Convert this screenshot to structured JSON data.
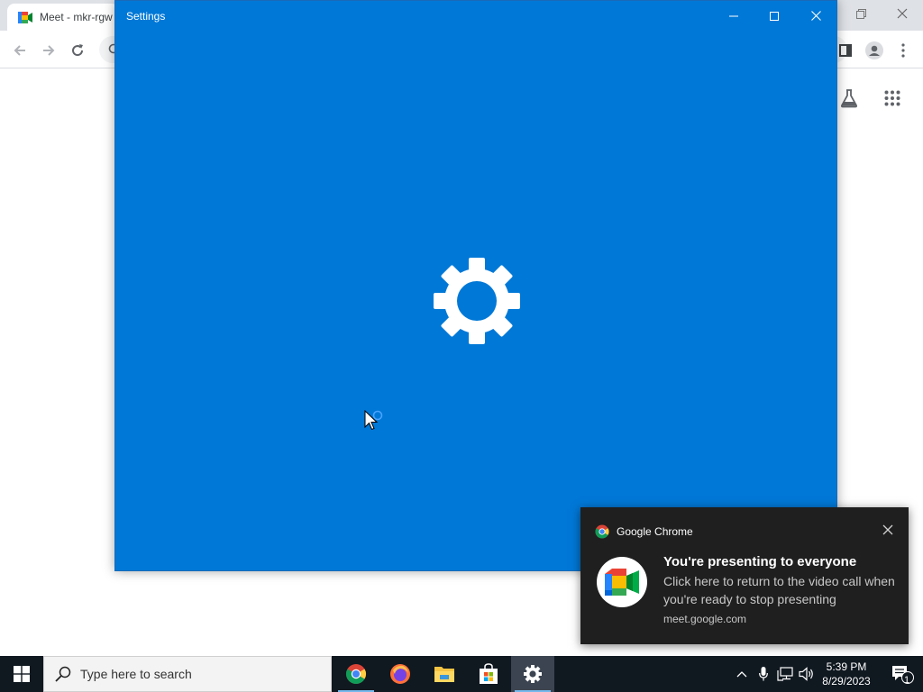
{
  "chrome": {
    "tab_title": "Meet - mkr-rgw",
    "window_controls": [
      "restore-icon",
      "close-icon"
    ],
    "toolbar_icons": [
      "back-arrow-icon",
      "forward-arrow-icon",
      "reload-icon",
      "search-icon",
      "side-panel-icon",
      "profile-icon",
      "more-menu-icon"
    ],
    "page_icons": [
      "labs-flask-icon",
      "apps-grid-icon"
    ]
  },
  "settings_window": {
    "title": "Settings",
    "controls": [
      "minimize-icon",
      "maximize-icon",
      "close-icon"
    ],
    "background_color": "#0078d7",
    "splash_icon": "gear-icon"
  },
  "toast": {
    "app_name": "Google Chrome",
    "heading": "You're presenting to everyone",
    "body": "Click here to return to the video call when you're ready to stop presenting",
    "source": "meet.google.com",
    "icon": "google-meet-icon"
  },
  "taskbar": {
    "search_placeholder": "Type here to search",
    "apps": [
      "chrome-icon",
      "firefox-icon",
      "file-explorer-icon",
      "microsoft-store-icon",
      "settings-icon"
    ],
    "active_app": "settings-icon",
    "tray_icons": [
      "chevron-up-icon",
      "microphone-icon",
      "network-icon",
      "volume-icon"
    ],
    "time": "5:39 PM",
    "date": "8/29/2023",
    "notification_count": "1"
  }
}
